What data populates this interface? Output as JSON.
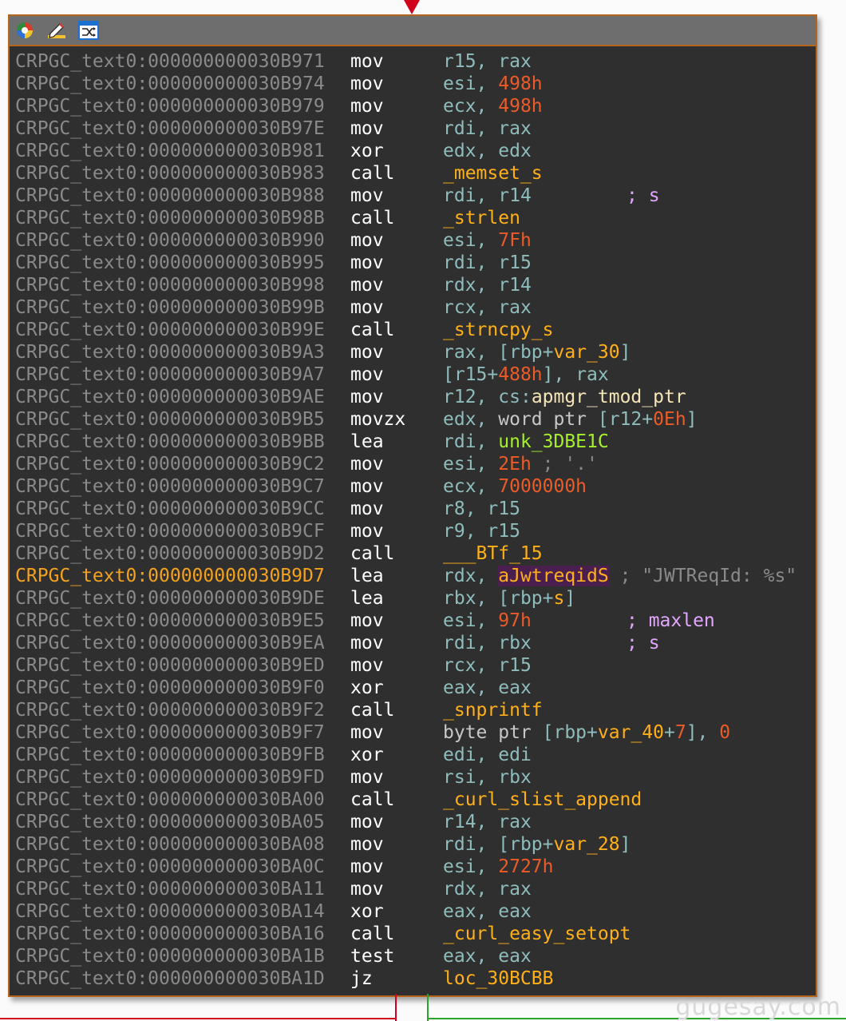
{
  "rows": [
    {
      "addr": "CRPGC_text0:000000000030B971",
      "mn": "mov",
      "ops": [
        {
          "t": "r15",
          "c": "rg"
        },
        {
          "t": ", ",
          "c": "rg"
        },
        {
          "t": "rax",
          "c": "rg"
        }
      ],
      "cmt": ""
    },
    {
      "addr": "CRPGC_text0:000000000030B974",
      "mn": "mov",
      "ops": [
        {
          "t": "esi",
          "c": "rg"
        },
        {
          "t": ", ",
          "c": "rg"
        },
        {
          "t": "498h",
          "c": "num"
        }
      ],
      "cmt": ""
    },
    {
      "addr": "CRPGC_text0:000000000030B979",
      "mn": "mov",
      "ops": [
        {
          "t": "ecx",
          "c": "rg"
        },
        {
          "t": ", ",
          "c": "rg"
        },
        {
          "t": "498h",
          "c": "num"
        }
      ],
      "cmt": ""
    },
    {
      "addr": "CRPGC_text0:000000000030B97E",
      "mn": "mov",
      "ops": [
        {
          "t": "rdi",
          "c": "rg"
        },
        {
          "t": ", ",
          "c": "rg"
        },
        {
          "t": "rax",
          "c": "rg"
        }
      ],
      "cmt": ""
    },
    {
      "addr": "CRPGC_text0:000000000030B981",
      "mn": "xor",
      "ops": [
        {
          "t": "edx",
          "c": "rg"
        },
        {
          "t": ", ",
          "c": "rg"
        },
        {
          "t": "edx",
          "c": "rg"
        }
      ],
      "cmt": ""
    },
    {
      "addr": "CRPGC_text0:000000000030B983",
      "mn": "call",
      "ops": [
        {
          "t": "_memset_s",
          "c": "lbl"
        }
      ],
      "cmt": ""
    },
    {
      "addr": "CRPGC_text0:000000000030B988",
      "mn": "mov",
      "ops": [
        {
          "t": "rdi",
          "c": "rg"
        },
        {
          "t": ", ",
          "c": "rg"
        },
        {
          "t": "r14",
          "c": "rg"
        }
      ],
      "cmt": "; s"
    },
    {
      "addr": "CRPGC_text0:000000000030B98B",
      "mn": "call",
      "ops": [
        {
          "t": "_strlen",
          "c": "lbl"
        }
      ],
      "cmt": ""
    },
    {
      "addr": "CRPGC_text0:000000000030B990",
      "mn": "mov",
      "ops": [
        {
          "t": "esi",
          "c": "rg"
        },
        {
          "t": ", ",
          "c": "rg"
        },
        {
          "t": "7Fh",
          "c": "num"
        }
      ],
      "cmt": ""
    },
    {
      "addr": "CRPGC_text0:000000000030B995",
      "mn": "mov",
      "ops": [
        {
          "t": "rdi",
          "c": "rg"
        },
        {
          "t": ", ",
          "c": "rg"
        },
        {
          "t": "r15",
          "c": "rg"
        }
      ],
      "cmt": ""
    },
    {
      "addr": "CRPGC_text0:000000000030B998",
      "mn": "mov",
      "ops": [
        {
          "t": "rdx",
          "c": "rg"
        },
        {
          "t": ", ",
          "c": "rg"
        },
        {
          "t": "r14",
          "c": "rg"
        }
      ],
      "cmt": ""
    },
    {
      "addr": "CRPGC_text0:000000000030B99B",
      "mn": "mov",
      "ops": [
        {
          "t": "rcx",
          "c": "rg"
        },
        {
          "t": ", ",
          "c": "rg"
        },
        {
          "t": "rax",
          "c": "rg"
        }
      ],
      "cmt": ""
    },
    {
      "addr": "CRPGC_text0:000000000030B99E",
      "mn": "call",
      "ops": [
        {
          "t": "_strncpy_s",
          "c": "lbl"
        }
      ],
      "cmt": ""
    },
    {
      "addr": "CRPGC_text0:000000000030B9A3",
      "mn": "mov",
      "ops": [
        {
          "t": "rax",
          "c": "rg"
        },
        {
          "t": ", [",
          "c": "rg"
        },
        {
          "t": "rbp",
          "c": "rg"
        },
        {
          "t": "+",
          "c": "rg"
        },
        {
          "t": "var_30",
          "c": "lbl"
        },
        {
          "t": "]",
          "c": "rg"
        }
      ],
      "cmt": ""
    },
    {
      "addr": "CRPGC_text0:000000000030B9A7",
      "mn": "mov",
      "ops": [
        {
          "t": "[",
          "c": "rg"
        },
        {
          "t": "r15",
          "c": "rg"
        },
        {
          "t": "+",
          "c": "rg"
        },
        {
          "t": "488h",
          "c": "num"
        },
        {
          "t": "], ",
          "c": "rg"
        },
        {
          "t": "rax",
          "c": "rg"
        }
      ],
      "cmt": ""
    },
    {
      "addr": "CRPGC_text0:000000000030B9AE",
      "mn": "mov",
      "ops": [
        {
          "t": "r12",
          "c": "rg"
        },
        {
          "t": ", ",
          "c": "rg"
        },
        {
          "t": "cs",
          "c": "rg"
        },
        {
          "t": ":",
          "c": "rg"
        },
        {
          "t": "apmgr_tmod_ptr",
          "c": "kwl"
        }
      ],
      "cmt": ""
    },
    {
      "addr": "CRPGC_text0:000000000030B9B5",
      "mn": "movzx",
      "ops": [
        {
          "t": "edx",
          "c": "rg"
        },
        {
          "t": ", ",
          "c": "rg"
        },
        {
          "t": "word ptr ",
          "c": "kw"
        },
        {
          "t": "[",
          "c": "rg"
        },
        {
          "t": "r12",
          "c": "rg"
        },
        {
          "t": "+",
          "c": "rg"
        },
        {
          "t": "0Eh",
          "c": "num"
        },
        {
          "t": "]",
          "c": "rg"
        }
      ],
      "cmt": ""
    },
    {
      "addr": "CRPGC_text0:000000000030B9BB",
      "mn": "lea",
      "ops": [
        {
          "t": "rdi",
          "c": "rg"
        },
        {
          "t": ", ",
          "c": "rg"
        },
        {
          "t": "unk_3DBE1C",
          "c": "dat"
        }
      ],
      "cmt": ""
    },
    {
      "addr": "CRPGC_text0:000000000030B9C2",
      "mn": "mov",
      "ops": [
        {
          "t": "esi",
          "c": "rg"
        },
        {
          "t": ", ",
          "c": "rg"
        },
        {
          "t": "2Eh",
          "c": "num"
        },
        {
          "t": " ; '.'",
          "c": "str"
        }
      ],
      "cmt": ""
    },
    {
      "addr": "CRPGC_text0:000000000030B9C7",
      "mn": "mov",
      "ops": [
        {
          "t": "ecx",
          "c": "rg"
        },
        {
          "t": ", ",
          "c": "rg"
        },
        {
          "t": "7000000h",
          "c": "num"
        }
      ],
      "cmt": ""
    },
    {
      "addr": "CRPGC_text0:000000000030B9CC",
      "mn": "mov",
      "ops": [
        {
          "t": "r8",
          "c": "rg"
        },
        {
          "t": ", ",
          "c": "rg"
        },
        {
          "t": "r15",
          "c": "rg"
        }
      ],
      "cmt": ""
    },
    {
      "addr": "CRPGC_text0:000000000030B9CF",
      "mn": "mov",
      "ops": [
        {
          "t": "r9",
          "c": "rg"
        },
        {
          "t": ", ",
          "c": "rg"
        },
        {
          "t": "r15",
          "c": "rg"
        }
      ],
      "cmt": ""
    },
    {
      "addr": "CRPGC_text0:000000000030B9D2",
      "mn": "call",
      "ops": [
        {
          "t": "___BTf_15",
          "c": "lbl"
        }
      ],
      "cmt": ""
    },
    {
      "addr": "CRPGC_text0:000000000030B9D7",
      "mn": "lea",
      "ops": [
        {
          "t": "rdx",
          "c": "rg"
        },
        {
          "t": ", ",
          "c": "rg"
        },
        {
          "t": "aJwtreqidS",
          "c": "hl"
        },
        {
          "t": " ; \"JWTReqId: %s\"",
          "c": "str"
        }
      ],
      "cmt": "",
      "current": true
    },
    {
      "addr": "CRPGC_text0:000000000030B9DE",
      "mn": "lea",
      "ops": [
        {
          "t": "rbx",
          "c": "rg"
        },
        {
          "t": ", [",
          "c": "rg"
        },
        {
          "t": "rbp",
          "c": "rg"
        },
        {
          "t": "+",
          "c": "rg"
        },
        {
          "t": "s",
          "c": "lbl"
        },
        {
          "t": "]",
          "c": "rg"
        }
      ],
      "cmt": ""
    },
    {
      "addr": "CRPGC_text0:000000000030B9E5",
      "mn": "mov",
      "ops": [
        {
          "t": "esi",
          "c": "rg"
        },
        {
          "t": ", ",
          "c": "rg"
        },
        {
          "t": "97h",
          "c": "num"
        }
      ],
      "cmt": "; maxlen"
    },
    {
      "addr": "CRPGC_text0:000000000030B9EA",
      "mn": "mov",
      "ops": [
        {
          "t": "rdi",
          "c": "rg"
        },
        {
          "t": ", ",
          "c": "rg"
        },
        {
          "t": "rbx",
          "c": "rg"
        }
      ],
      "cmt": "; s"
    },
    {
      "addr": "CRPGC_text0:000000000030B9ED",
      "mn": "mov",
      "ops": [
        {
          "t": "rcx",
          "c": "rg"
        },
        {
          "t": ", ",
          "c": "rg"
        },
        {
          "t": "r15",
          "c": "rg"
        }
      ],
      "cmt": ""
    },
    {
      "addr": "CRPGC_text0:000000000030B9F0",
      "mn": "xor",
      "ops": [
        {
          "t": "eax",
          "c": "rg"
        },
        {
          "t": ", ",
          "c": "rg"
        },
        {
          "t": "eax",
          "c": "rg"
        }
      ],
      "cmt": ""
    },
    {
      "addr": "CRPGC_text0:000000000030B9F2",
      "mn": "call",
      "ops": [
        {
          "t": "_snprintf",
          "c": "lbl"
        }
      ],
      "cmt": ""
    },
    {
      "addr": "CRPGC_text0:000000000030B9F7",
      "mn": "mov",
      "ops": [
        {
          "t": "byte ptr ",
          "c": "kw"
        },
        {
          "t": "[",
          "c": "rg"
        },
        {
          "t": "rbp",
          "c": "rg"
        },
        {
          "t": "+",
          "c": "rg"
        },
        {
          "t": "var_40",
          "c": "lbl"
        },
        {
          "t": "+",
          "c": "rg"
        },
        {
          "t": "7",
          "c": "num"
        },
        {
          "t": "], ",
          "c": "rg"
        },
        {
          "t": "0",
          "c": "num"
        }
      ],
      "cmt": ""
    },
    {
      "addr": "CRPGC_text0:000000000030B9FB",
      "mn": "xor",
      "ops": [
        {
          "t": "edi",
          "c": "rg"
        },
        {
          "t": ", ",
          "c": "rg"
        },
        {
          "t": "edi",
          "c": "rg"
        }
      ],
      "cmt": ""
    },
    {
      "addr": "CRPGC_text0:000000000030B9FD",
      "mn": "mov",
      "ops": [
        {
          "t": "rsi",
          "c": "rg"
        },
        {
          "t": ", ",
          "c": "rg"
        },
        {
          "t": "rbx",
          "c": "rg"
        }
      ],
      "cmt": ""
    },
    {
      "addr": "CRPGC_text0:000000000030BA00",
      "mn": "call",
      "ops": [
        {
          "t": "_curl_slist_append",
          "c": "lbl"
        }
      ],
      "cmt": ""
    },
    {
      "addr": "CRPGC_text0:000000000030BA05",
      "mn": "mov",
      "ops": [
        {
          "t": "r14",
          "c": "rg"
        },
        {
          "t": ", ",
          "c": "rg"
        },
        {
          "t": "rax",
          "c": "rg"
        }
      ],
      "cmt": ""
    },
    {
      "addr": "CRPGC_text0:000000000030BA08",
      "mn": "mov",
      "ops": [
        {
          "t": "rdi",
          "c": "rg"
        },
        {
          "t": ", [",
          "c": "rg"
        },
        {
          "t": "rbp",
          "c": "rg"
        },
        {
          "t": "+",
          "c": "rg"
        },
        {
          "t": "var_28",
          "c": "lbl"
        },
        {
          "t": "]",
          "c": "rg"
        }
      ],
      "cmt": ""
    },
    {
      "addr": "CRPGC_text0:000000000030BA0C",
      "mn": "mov",
      "ops": [
        {
          "t": "esi",
          "c": "rg"
        },
        {
          "t": ", ",
          "c": "rg"
        },
        {
          "t": "2727h",
          "c": "num"
        }
      ],
      "cmt": ""
    },
    {
      "addr": "CRPGC_text0:000000000030BA11",
      "mn": "mov",
      "ops": [
        {
          "t": "rdx",
          "c": "rg"
        },
        {
          "t": ", ",
          "c": "rg"
        },
        {
          "t": "rax",
          "c": "rg"
        }
      ],
      "cmt": ""
    },
    {
      "addr": "CRPGC_text0:000000000030BA14",
      "mn": "xor",
      "ops": [
        {
          "t": "eax",
          "c": "rg"
        },
        {
          "t": ", ",
          "c": "rg"
        },
        {
          "t": "eax",
          "c": "rg"
        }
      ],
      "cmt": ""
    },
    {
      "addr": "CRPGC_text0:000000000030BA16",
      "mn": "call",
      "ops": [
        {
          "t": "_curl_easy_setopt",
          "c": "lbl"
        }
      ],
      "cmt": ""
    },
    {
      "addr": "CRPGC_text0:000000000030BA1B",
      "mn": "test",
      "ops": [
        {
          "t": "eax",
          "c": "rg"
        },
        {
          "t": ", ",
          "c": "rg"
        },
        {
          "t": "eax",
          "c": "rg"
        }
      ],
      "cmt": ""
    },
    {
      "addr": "CRPGC_text0:000000000030BA1D",
      "mn": "jz",
      "ops": [
        {
          "t": "loc_30BCBB",
          "c": "lbl"
        }
      ],
      "cmt": ""
    }
  ],
  "toolbar": {
    "icons": [
      "color-wheel-icon",
      "edit-pencil-icon",
      "graph-shuffle-icon"
    ]
  },
  "watermark": "gugesay.com",
  "colors": {
    "background": "#2f2f2f",
    "border": "#b5651d",
    "address": "#8a8a8a",
    "current_address": "#f4a21d",
    "mnemonic": "#ffffff",
    "register": "#8fbcbc",
    "number": "#ec5b28",
    "label": "#ffb019",
    "data": "#a6f02b",
    "comment": "#e3a6ff",
    "highlight": "#4a1f4f",
    "true_edge": "#2aa52a",
    "false_edge": "#d0021b"
  }
}
